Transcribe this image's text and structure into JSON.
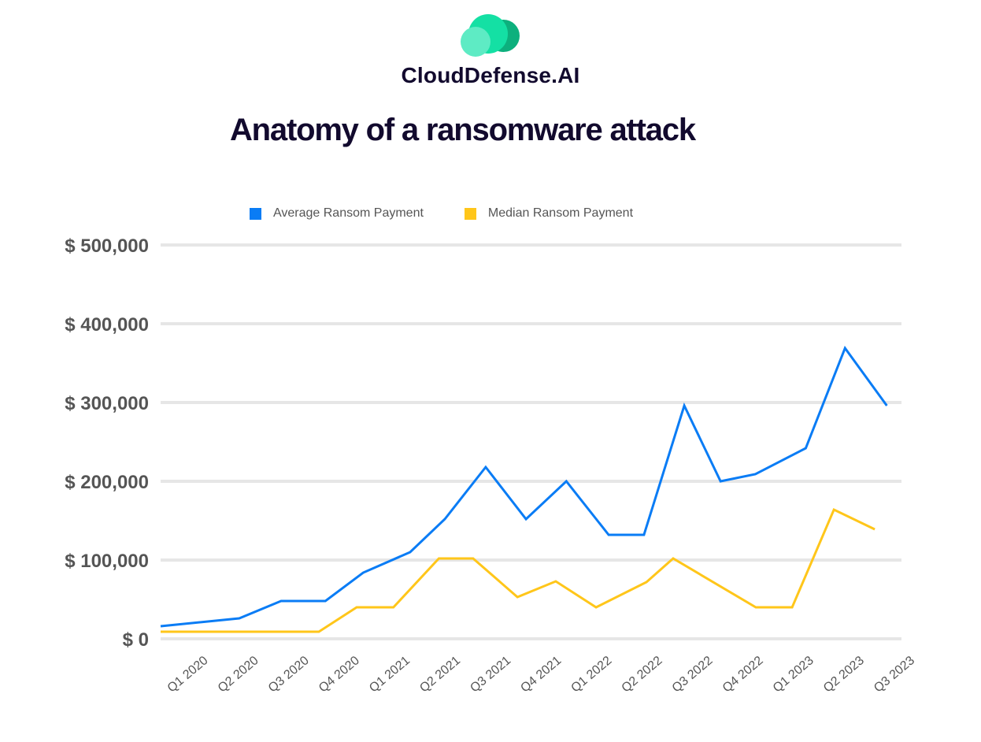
{
  "brand": {
    "name": "CloudDefense.AI",
    "logo_colors": {
      "front": "#5EEBC4",
      "middle": "#14E0A4",
      "back": "#0DB07D"
    },
    "text_color": "#120A2E"
  },
  "chart_data": {
    "type": "line",
    "title": "Anatomy of a ransomware attack",
    "xlabel": "",
    "ylabel": "",
    "categories": [
      "Q1 2020",
      "Q2 2020",
      "Q3 2020",
      "Q4 2020",
      "Q1 2021",
      "Q2 2021",
      "Q3 2021",
      "Q4 2021",
      "Q1 2022",
      "Q2 2022",
      "Q3 2022",
      "Q4 2022",
      "Q1 2023",
      "Q2 2023",
      "Q3 2023"
    ],
    "yticks": [
      0,
      100000,
      200000,
      300000,
      400000,
      500000
    ],
    "ytick_labels": [
      "$ 0",
      "$ 100,000",
      "$ 200,000",
      "$ 300,000",
      "$ 400,000",
      "$ 500,000"
    ],
    "ylim": [
      0,
      500000
    ],
    "xlim": [
      0,
      14.7
    ],
    "grid": true,
    "legend_position": "top-center",
    "series": [
      {
        "name": "Average Ransom Payment",
        "color": "#0A7CF5",
        "x": [
          0,
          1.56,
          2.39,
          3.27,
          4.02,
          4.95,
          5.64,
          6.45,
          7.25,
          8.05,
          8.89,
          9.59,
          10.39,
          11.11,
          11.8,
          12.8,
          13.58,
          14.41
        ],
        "values": [
          16000,
          26000,
          48000,
          48000,
          84000,
          110000,
          152000,
          218000,
          152000,
          200000,
          132000,
          132000,
          296000,
          200000,
          209000,
          242000,
          369000,
          296000
        ]
      },
      {
        "name": "Median Ransom Payment",
        "color": "#FFC61A",
        "x": [
          0,
          3.14,
          3.89,
          4.62,
          5.52,
          6.2,
          7.08,
          7.84,
          8.64,
          9.64,
          10.17,
          11.81,
          12.53,
          13.36,
          14.17
        ],
        "values": [
          9000,
          9000,
          40000,
          40000,
          102000,
          102000,
          53000,
          73000,
          40000,
          72000,
          102000,
          40000,
          40000,
          164000,
          139000
        ]
      }
    ]
  }
}
